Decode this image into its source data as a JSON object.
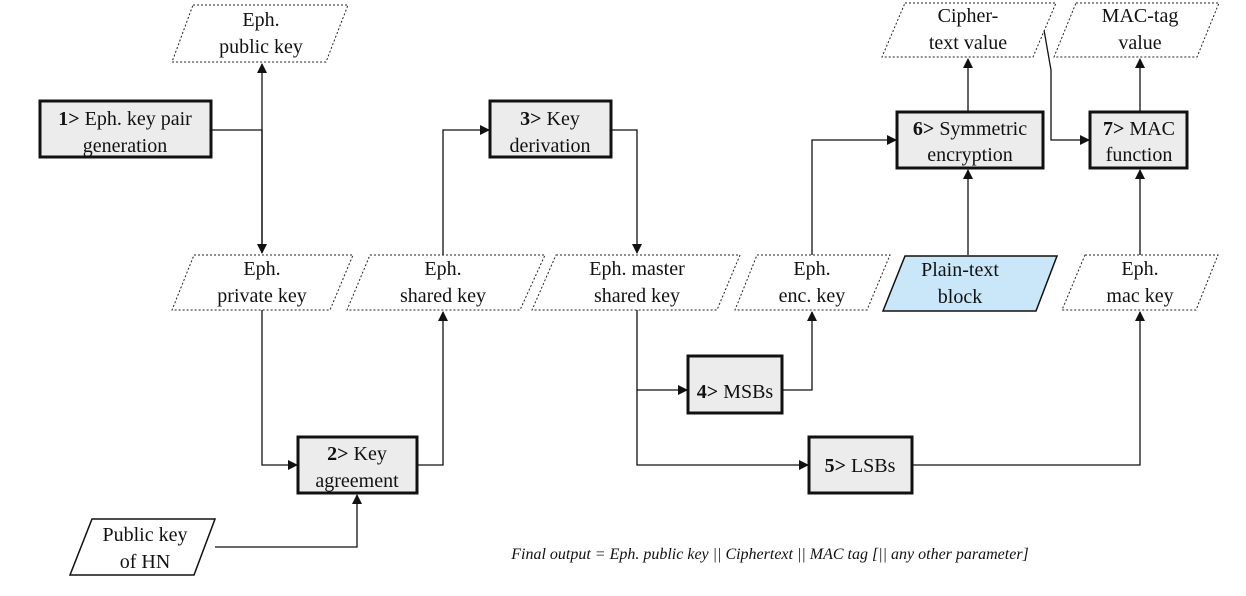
{
  "processes": {
    "p1": {
      "num": "1>",
      "line1": "Eph. key pair",
      "line2": "generation"
    },
    "p2": {
      "num": "2>",
      "line1": "Key",
      "line2": "agreement"
    },
    "p3": {
      "num": "3>",
      "line1": "Key",
      "line2": "derivation"
    },
    "p4": {
      "num": "4>",
      "line1": "MSBs"
    },
    "p5": {
      "num": "5>",
      "line1": "LSBs"
    },
    "p6": {
      "num": "6>",
      "line1": "Symmetric",
      "line2": "encryption"
    },
    "p7": {
      "num": "7>",
      "line1": "MAC",
      "line2": "function"
    }
  },
  "data_items": {
    "pub": {
      "line1": "Eph.",
      "line2": "public key"
    },
    "priv": {
      "line1": "Eph.",
      "line2": "private key"
    },
    "shared": {
      "line1": "Eph.",
      "line2": "shared key"
    },
    "master": {
      "line1": "Eph. master",
      "line2": "shared key"
    },
    "enc": {
      "line1": "Eph.",
      "line2": "enc. key"
    },
    "plain": {
      "line1": "Plain-text",
      "line2": "block"
    },
    "mac": {
      "line1": "Eph.",
      "line2": "mac key"
    },
    "cipher": {
      "line1": "Cipher-",
      "line2": "text value"
    },
    "tag": {
      "line1": "MAC-tag",
      "line2": "value"
    },
    "hn": {
      "line1": "Public key",
      "line2": "of HN"
    }
  },
  "footer": "Final output = Eph. public key || Ciphertext || MAC tag [|| any other parameter]",
  "colors": {
    "process_fill": "#ececec",
    "plaintext_fill": "#c9e7f8"
  }
}
